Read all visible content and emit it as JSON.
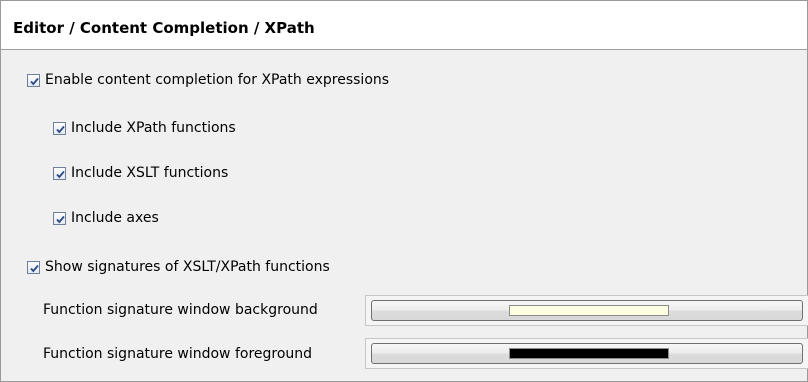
{
  "header": {
    "title": "Editor / Content Completion / XPath"
  },
  "options": {
    "enable_completion": {
      "label": "Enable content completion for XPath expressions",
      "checked": true
    },
    "include_xpath_functions": {
      "label": "Include XPath functions",
      "checked": true
    },
    "include_xslt_functions": {
      "label": "Include XSLT functions",
      "checked": true
    },
    "include_axes": {
      "label": "Include axes",
      "checked": true
    },
    "show_signatures": {
      "label": "Show signatures of XSLT/XPath functions",
      "checked": true
    }
  },
  "colors": {
    "background_label": "Function signature window background",
    "background_color": "#ffffe1",
    "foreground_label": "Function signature window foreground",
    "foreground_color": "#000000"
  },
  "icons": {
    "checkbox_check": "check-icon"
  }
}
